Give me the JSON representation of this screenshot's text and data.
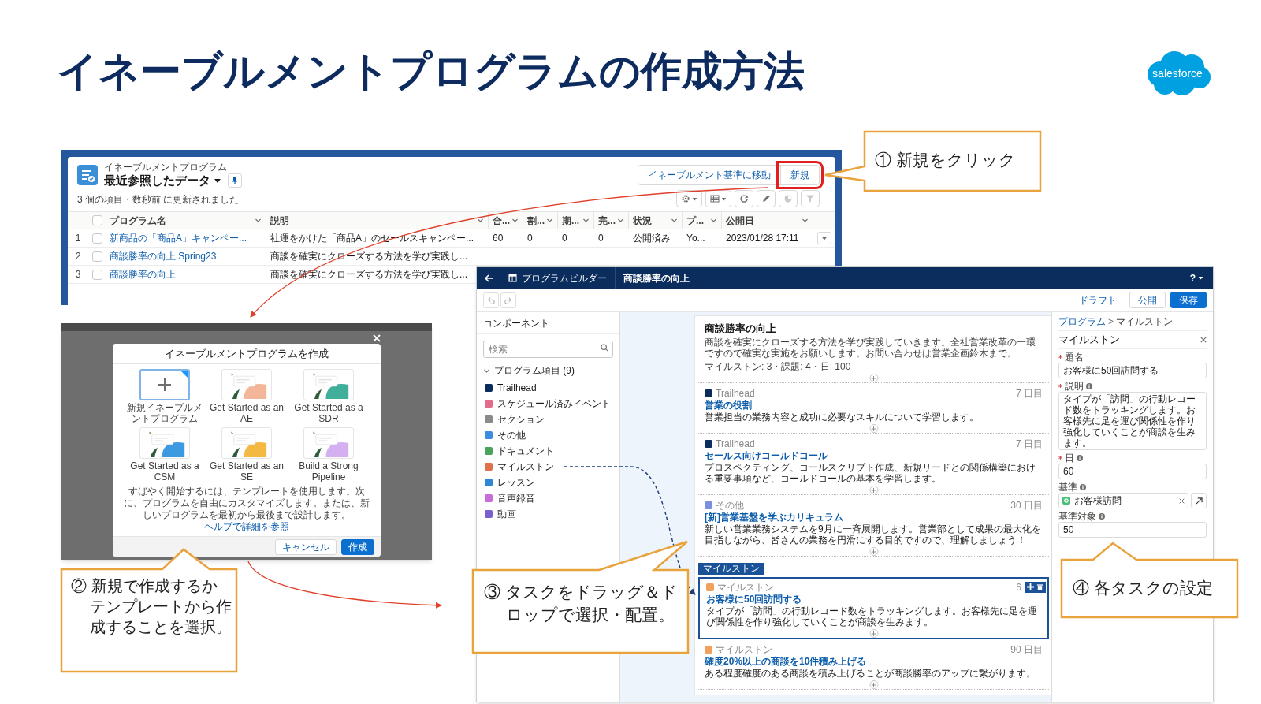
{
  "slide_title": "イネーブルメントプログラムの作成方法",
  "logo": "salesforce",
  "list_view": {
    "object_label": "イネーブルメントプログラム",
    "view_name": "最近参照したデータ",
    "status": "3 個の項目・数秒前 に更新されました",
    "buttons": [
      {
        "label": "イネーブルメント基準に移動",
        "highlighted": false
      },
      {
        "label": "新規",
        "highlighted": true
      }
    ],
    "select_all_checked": false,
    "columns": [
      "プログラム名",
      "説明",
      "合...",
      "割...",
      "期...",
      "完...",
      "状況",
      "プ...",
      "公開日"
    ],
    "rows": [
      {
        "number": "1",
        "checked": false,
        "menu": true,
        "cells": [
          "新商品の「商品A」キャンペー...",
          "社運をかけた「商品A」のセールスキャンペー...",
          "60",
          "0",
          "0",
          "0",
          "公開済み",
          "Yo...",
          "2023/01/28 17:11"
        ]
      },
      {
        "number": "2",
        "checked": false,
        "menu": false,
        "cells": [
          "商談勝率の向上 Spring23",
          "商談を確実にクローズする方法を学び実践し..."
        ]
      },
      {
        "number": "3",
        "checked": false,
        "menu": false,
        "cells": [
          "商談勝率の向上",
          "商談を確実にクローズする方法を学び実践し..."
        ]
      }
    ]
  },
  "create_dialog": {
    "title": "イネーブルメントプログラムを作成",
    "templates": [
      {
        "label": "新規イネーブルメントプログラム",
        "kind": "blank",
        "selected": true
      },
      {
        "label": "Get Started as an AE",
        "kind": "template",
        "color": "#f3b699",
        "selected": false
      },
      {
        "label": "Get Started as a SDR",
        "kind": "template",
        "color": "#3fae9a",
        "selected": false
      },
      {
        "label": "Get Started as a CSM",
        "kind": "template",
        "color": "#3c9be0",
        "selected": false
      },
      {
        "label": "Get Started as an SE",
        "kind": "template",
        "color": "#f4b942",
        "selected": false
      },
      {
        "label": "Build a Strong Pipeline",
        "kind": "template",
        "color": "#d4b0f2",
        "selected": false
      }
    ],
    "help_text": "すばやく開始するには、テンプレートを使用します。次に、プログラムを自由にカスタマイズします。または、新しいプログラムを最初から最後まで設計します。",
    "help_link": "ヘルプで詳細を参照",
    "buttons": [
      {
        "label": "キャンセル",
        "kind": "neutral"
      },
      {
        "label": "作成",
        "kind": "brand"
      }
    ]
  },
  "builder": {
    "app_title": "プログラムビルダー",
    "program_name": "商談勝率の向上",
    "help_label": "?",
    "status_link": "ドラフト",
    "actions": [
      {
        "label": "公開",
        "kind": "neutral"
      },
      {
        "label": "保存",
        "kind": "brand"
      }
    ],
    "components": {
      "title": "コンポーネント",
      "search_placeholder": "検索",
      "group": "プログラム項目 (9)",
      "expanded": true,
      "items": [
        {
          "label": "Trailhead",
          "color": "#0b2d5e",
          "dragging": false
        },
        {
          "label": "スケジュール済みイベント",
          "color": "#e46c8a",
          "dragging": false
        },
        {
          "label": "セクション",
          "color": "#8a8a8a",
          "dragging": false
        },
        {
          "label": "その他",
          "color": "#3a8de0",
          "dragging": false
        },
        {
          "label": "ドキュメント",
          "color": "#4aa35b",
          "dragging": false
        },
        {
          "label": "マイルストン",
          "color": "#e0714a",
          "dragging": true
        },
        {
          "label": "レッスン",
          "color": "#2f86d6",
          "dragging": false
        },
        {
          "label": "音声録音",
          "color": "#c86cd8",
          "dragging": false
        },
        {
          "label": "動画",
          "color": "#7a5fd1",
          "dragging": false
        }
      ]
    },
    "outline": {
      "title": "商談勝率の向上",
      "description": "商談を確実にクローズする方法を学び実践していきます。全社営業改革の一環ですので確実な実施をお願いします。お問い合わせは営業企画鈴木まで。",
      "summary": "マイルストン: 3・課題: 4・日: 100",
      "items": [
        {
          "kind": "trailhead",
          "type": "Trailhead",
          "day": "7 日目",
          "title": "営業の役割",
          "description": "営業担当の業務内容と成功に必要なスキルについて学習します。",
          "selected": false
        },
        {
          "kind": "trailhead",
          "type": "Trailhead",
          "day": "7 日目",
          "title": "セールス向けコールドコール",
          "description": "プロスペクティング、コールスクリプト作成、新規リードとの関係構築における重要事項など、コールドコールの基本を学習します。",
          "selected": false
        },
        {
          "kind": "other",
          "type": "その他",
          "day": "30 日目",
          "title": "[新]営業基盤を学ぶカリキュラム",
          "description": "新しい営業業務システムを9月に一斉展開します。営業部として成果の最大化を目指しながら、皆さんの業務を円滑にする目的ですので、理解しましょう！",
          "selected": false
        },
        {
          "kind": "milestone",
          "type": "マイルストン",
          "day": "6",
          "drag_label": "マイルストン",
          "title": "お客様に50回訪問する",
          "description": "タイプが「訪問」の行動レコード数をトラッキングします。お客様先に足を運び関係性を作り強化していくことが商談を生みます。",
          "selected": true
        },
        {
          "kind": "milestone",
          "type": "マイルストン",
          "day": "90 日目",
          "title": "確度20%以上の商談を10件積み上げる",
          "description": "ある程度確度のある商談を積み上げることが商談勝率のアップに繋がります。",
          "selected": false
        }
      ]
    },
    "details": {
      "breadcrumb_link": "プログラム",
      "breadcrumb_separator": ">",
      "breadcrumb_current": "マイルストン",
      "title": "マイルストン",
      "fields": [
        {
          "label": "題名",
          "required": true,
          "info": false,
          "kind": "text",
          "value": "お客様に50回訪問する"
        },
        {
          "label": "説明",
          "required": true,
          "info": true,
          "kind": "textarea",
          "value": "タイプが「訪問」の行動レコード数をトラッキングします。お客様先に足を運び関係性を作り強化していくことが商談を生みます。"
        },
        {
          "label": "日",
          "required": true,
          "info": true,
          "kind": "text",
          "value": "60"
        },
        {
          "label": "基準",
          "required": false,
          "info": true,
          "kind": "lookup",
          "value": "お客様訪問"
        },
        {
          "label": "基準対象",
          "required": false,
          "info": true,
          "kind": "text",
          "value": "50"
        }
      ]
    }
  },
  "callouts": [
    {
      "text": "① 新規をクリック"
    },
    {
      "text": "② 新規で作成するかテンプレートから作成することを選択。"
    },
    {
      "text": "③ タスクをドラッグ＆ドロップで選択・配置。"
    },
    {
      "text": "④ 各タスクの設定"
    }
  ]
}
